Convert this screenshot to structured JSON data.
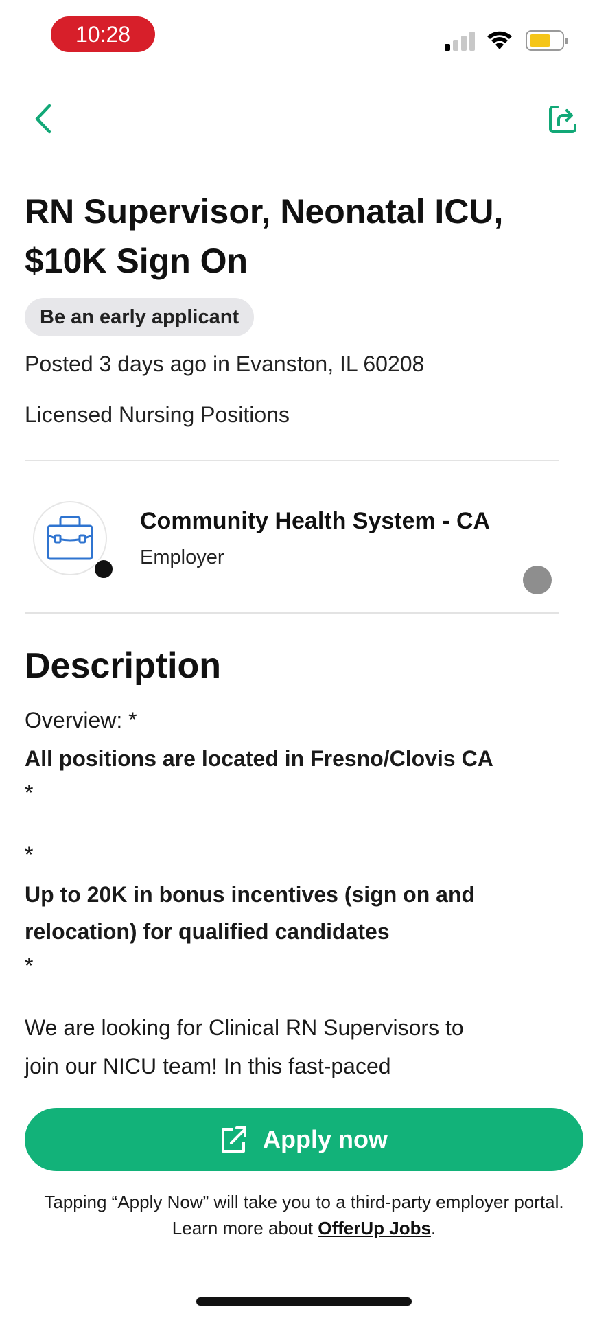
{
  "status_bar": {
    "time": "10:28",
    "signal_bars_active": 1,
    "signal_bars_total": 4,
    "battery_level": 0.6,
    "colors": {
      "time_pill": "#d71f2a",
      "battery": "#f5c518"
    }
  },
  "nav": {
    "back_icon": "chevron-left-icon",
    "share_icon": "share-icon"
  },
  "job": {
    "title": "RN Supervisor, Neonatal ICU, $10K Sign On",
    "badge": "Be an early applicant",
    "posted": "Posted 3 days ago in Evanston, IL 60208",
    "category": "Licensed Nursing Positions"
  },
  "employer": {
    "name": "Community Health System - CA",
    "role": "Employer",
    "logo_icon": "briefcase-icon"
  },
  "description": {
    "heading": "Description",
    "lines": [
      {
        "text": "Overview: *",
        "bold": false
      },
      {
        "text": "All positions are located in Fresno/Clovis CA",
        "bold": true
      },
      {
        "text": "*",
        "bold": false
      },
      {
        "text": "*",
        "bold": false
      },
      {
        "text": "Up to 20K in bonus incentives (sign on and",
        "bold": true
      },
      {
        "text": "relocation) for qualified candidates",
        "bold": true
      },
      {
        "text": "*",
        "bold": false
      },
      {
        "text": "We are looking for Clinical RN Supervisors to",
        "bold": false
      },
      {
        "text": "join our NICU team! In this fast-paced",
        "bold": false
      }
    ]
  },
  "apply": {
    "label": "Apply now",
    "icon": "external-link-icon",
    "color": "#12b279"
  },
  "disclaimer": {
    "line1": "Tapping “Apply Now” will take you to a third-party employer portal.",
    "line2_prefix": "Learn more about ",
    "link": "OfferUp Jobs",
    "line2_suffix": "."
  }
}
